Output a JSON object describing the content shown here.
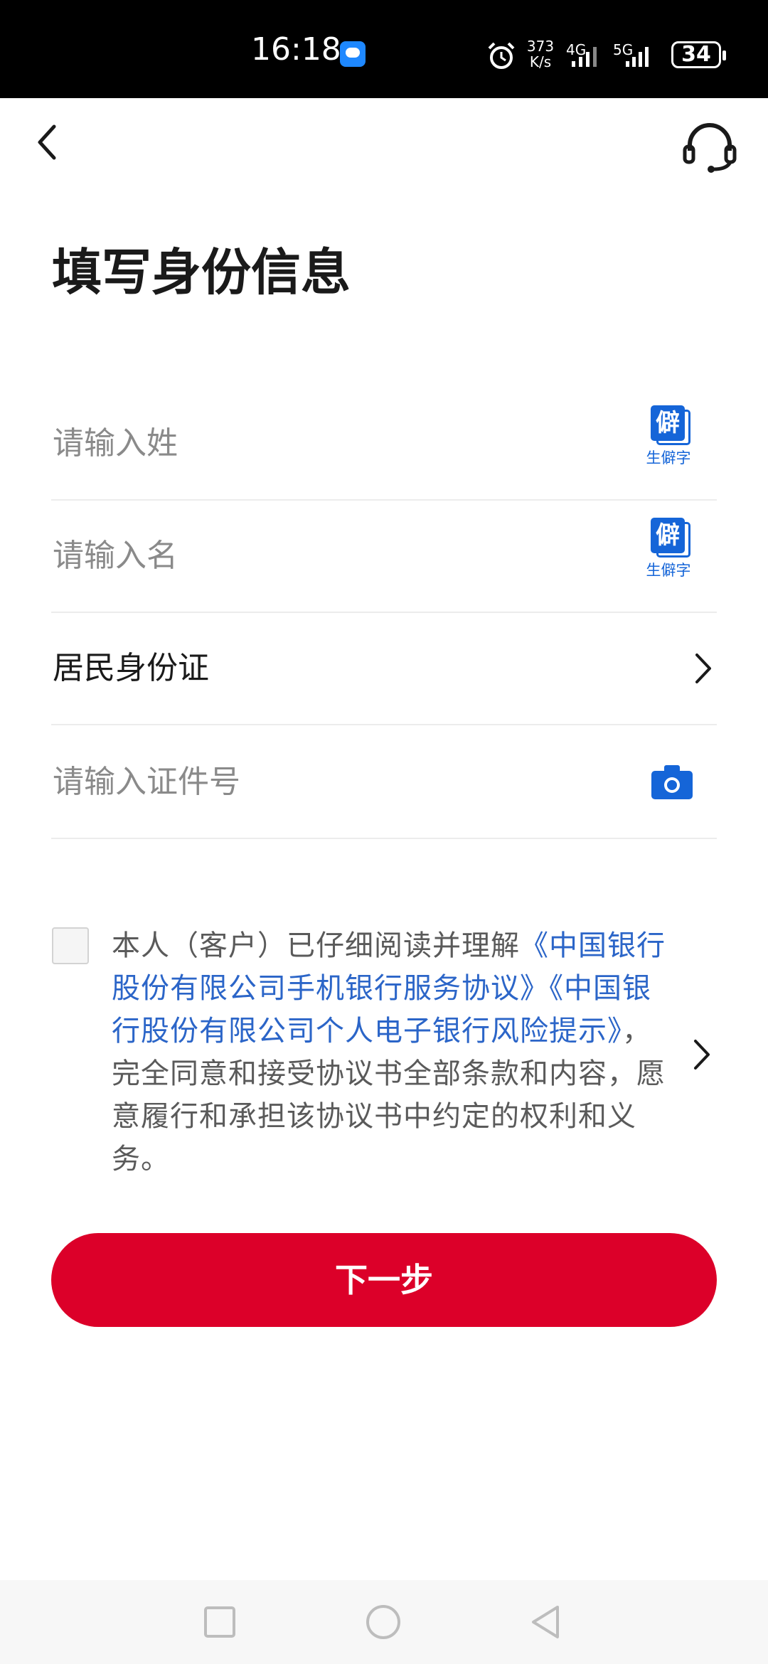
{
  "status_bar": {
    "time": "16:18",
    "net_speed_value": "373",
    "net_speed_unit": "K/s",
    "sim1_label": "4G",
    "sim2_label": "5G",
    "battery": "34"
  },
  "header": {
    "back_icon": "chevron-left-icon",
    "support_icon": "headset-icon"
  },
  "page": {
    "title": "填写身份信息"
  },
  "form": {
    "surname_placeholder": "请输入姓",
    "given_name_placeholder": "请输入名",
    "rare_char_label": "生僻字",
    "rare_char_glyph": "僻",
    "id_type_value": "居民身份证",
    "id_number_placeholder": "请输入证件号"
  },
  "agreement": {
    "prefix": "本人（客户）已仔细阅读并理解",
    "link1": "《中国银行股份有限公司手机银行服务协议》",
    "link2": "《中国银行股份有限公司个人电子银行风险提示》",
    "suffix": "，完全同意和接受协议书全部条款和内容，愿意履行和承担该协议书中约定的权利和义务。",
    "checked": false
  },
  "actions": {
    "next_label": "下一步"
  },
  "colors": {
    "primary_red": "#dc0029",
    "link_blue": "#2b65c8",
    "icon_blue": "#1565d8"
  }
}
